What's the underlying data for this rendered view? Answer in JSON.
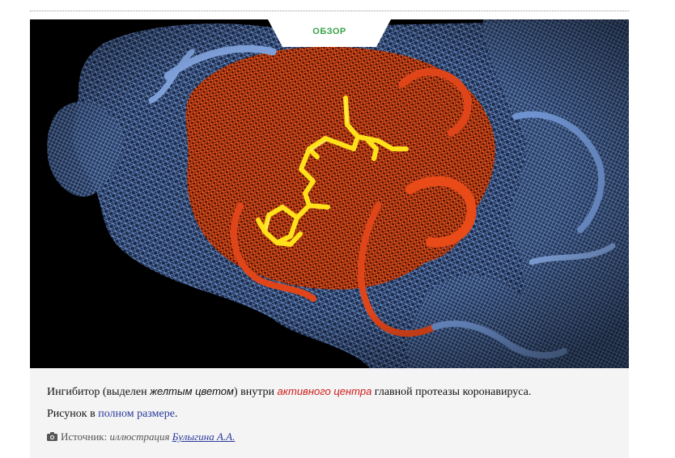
{
  "header": {
    "tab_label": "ОБЗОР"
  },
  "figure": {
    "image_icon": "molecule-image",
    "colors": {
      "background": "#000000",
      "protein_mesh": "#5c82c4",
      "active_site_mesh": "#e0451a",
      "inhibitor": "#ffe11a"
    }
  },
  "caption": {
    "text_before": "Ингибитор (выделен ",
    "highlight_yellow": "желтым цветом",
    "text_mid": ") внутри ",
    "highlight_red": "активного центра",
    "text_after": " главной протеазы коронавируса.",
    "link_prefix": "Рисунок в ",
    "link_text": "полном размере",
    "link_suffix": ".",
    "source_icon": "camera-icon",
    "source_label": "Источник: ",
    "source_italic": "иллюстрация",
    "source_author": "Булыгина А.А."
  }
}
